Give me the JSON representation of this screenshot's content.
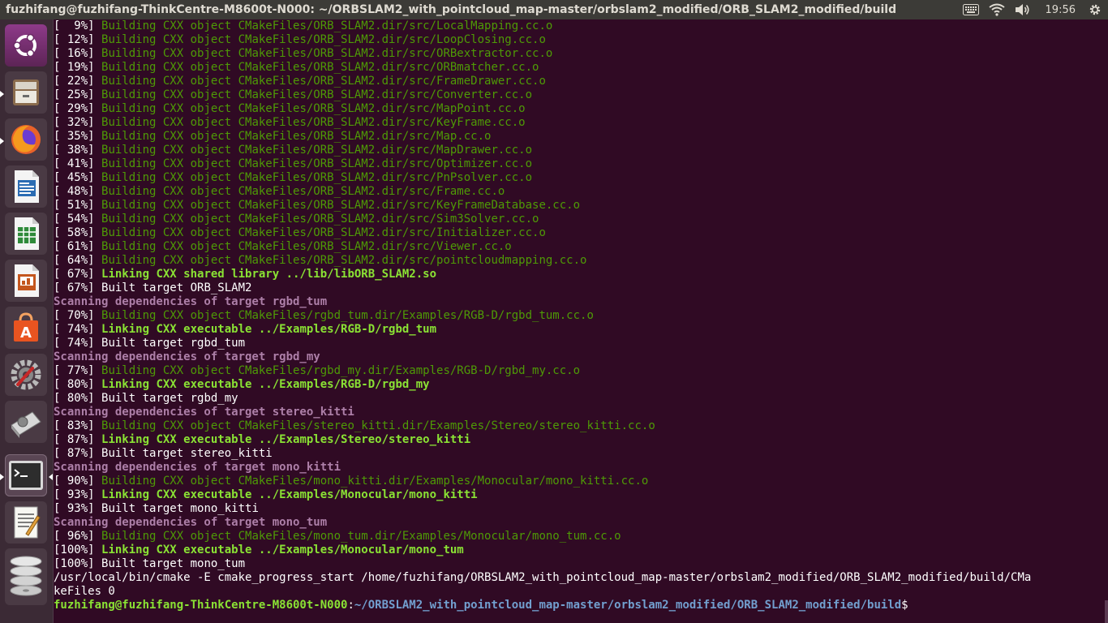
{
  "window": {
    "title": "fuzhifang@fuzhifang-ThinkCentre-M8600t-N000: ~/ORBSLAM2_with_pointcloud_map-master/orbslam2_modified/ORB_SLAM2_modified/build"
  },
  "indicators": {
    "keyboard_icon": "keyboard-icon",
    "wifi_icon": "wifi-icon",
    "volume_icon": "volume-icon",
    "time": "19:56",
    "gear_icon": "gear-icon"
  },
  "launcher": {
    "items": [
      {
        "name": "ubuntu-dash",
        "icon": "ubuntu-logo-icon"
      },
      {
        "name": "files",
        "icon": "files-cabinet-icon"
      },
      {
        "name": "firefox",
        "icon": "firefox-icon"
      },
      {
        "name": "libreoffice-writer",
        "icon": "writer-document-icon"
      },
      {
        "name": "libreoffice-calc",
        "icon": "calc-spreadsheet-icon"
      },
      {
        "name": "libreoffice-impress",
        "icon": "impress-presentation-icon"
      },
      {
        "name": "ubuntu-software",
        "icon": "software-bag-icon"
      },
      {
        "name": "system-settings",
        "icon": "settings-wrench-icon"
      },
      {
        "name": "disk-scanner",
        "icon": "scanner-icon"
      },
      {
        "name": "terminal",
        "icon": "terminal-icon"
      },
      {
        "name": "text-editor",
        "icon": "text-editor-icon"
      },
      {
        "name": "disks",
        "icon": "disk-stack-icon"
      }
    ]
  },
  "terminal": {
    "lines": [
      {
        "pct": "[  9%] ",
        "text": "Building CXX object CMakeFiles/ORB_SLAM2.dir/src/LocalMapping.cc.o"
      },
      {
        "pct": "[ 12%] ",
        "text": "Building CXX object CMakeFiles/ORB_SLAM2.dir/src/LoopClosing.cc.o"
      },
      {
        "pct": "[ 16%] ",
        "text": "Building CXX object CMakeFiles/ORB_SLAM2.dir/src/ORBextractor.cc.o"
      },
      {
        "pct": "[ 19%] ",
        "text": "Building CXX object CMakeFiles/ORB_SLAM2.dir/src/ORBmatcher.cc.o"
      },
      {
        "pct": "[ 22%] ",
        "text": "Building CXX object CMakeFiles/ORB_SLAM2.dir/src/FrameDrawer.cc.o"
      },
      {
        "pct": "[ 25%] ",
        "text": "Building CXX object CMakeFiles/ORB_SLAM2.dir/src/Converter.cc.o"
      },
      {
        "pct": "[ 29%] ",
        "text": "Building CXX object CMakeFiles/ORB_SLAM2.dir/src/MapPoint.cc.o"
      },
      {
        "pct": "[ 32%] ",
        "text": "Building CXX object CMakeFiles/ORB_SLAM2.dir/src/KeyFrame.cc.o"
      },
      {
        "pct": "[ 35%] ",
        "text": "Building CXX object CMakeFiles/ORB_SLAM2.dir/src/Map.cc.o"
      },
      {
        "pct": "[ 38%] ",
        "text": "Building CXX object CMakeFiles/ORB_SLAM2.dir/src/MapDrawer.cc.o"
      },
      {
        "pct": "[ 41%] ",
        "text": "Building CXX object CMakeFiles/ORB_SLAM2.dir/src/Optimizer.cc.o"
      },
      {
        "pct": "[ 45%] ",
        "text": "Building CXX object CMakeFiles/ORB_SLAM2.dir/src/PnPsolver.cc.o"
      },
      {
        "pct": "[ 48%] ",
        "text": "Building CXX object CMakeFiles/ORB_SLAM2.dir/src/Frame.cc.o"
      },
      {
        "pct": "[ 51%] ",
        "text": "Building CXX object CMakeFiles/ORB_SLAM2.dir/src/KeyFrameDatabase.cc.o"
      },
      {
        "pct": "[ 54%] ",
        "text": "Building CXX object CMakeFiles/ORB_SLAM2.dir/src/Sim3Solver.cc.o"
      },
      {
        "pct": "[ 58%] ",
        "text": "Building CXX object CMakeFiles/ORB_SLAM2.dir/src/Initializer.cc.o"
      },
      {
        "pct": "[ 61%] ",
        "text": "Building CXX object CMakeFiles/ORB_SLAM2.dir/src/Viewer.cc.o"
      },
      {
        "pct": "[ 64%] ",
        "text": "Building CXX object CMakeFiles/ORB_SLAM2.dir/src/pointcloudmapping.cc.o"
      },
      {
        "pct": "[ 67%] ",
        "text": "Linking CXX shared library ../lib/libORB_SLAM2.so"
      },
      {
        "pct": "[ 67%] ",
        "text": "Built target ORB_SLAM2"
      },
      {
        "pct": "",
        "text": "Scanning dependencies of target rgbd_tum"
      },
      {
        "pct": "[ 70%] ",
        "text": "Building CXX object CMakeFiles/rgbd_tum.dir/Examples/RGB-D/rgbd_tum.cc.o"
      },
      {
        "pct": "[ 74%] ",
        "text": "Linking CXX executable ../Examples/RGB-D/rgbd_tum"
      },
      {
        "pct": "[ 74%] ",
        "text": "Built target rgbd_tum"
      },
      {
        "pct": "",
        "text": "Scanning dependencies of target rgbd_my"
      },
      {
        "pct": "[ 77%] ",
        "text": "Building CXX object CMakeFiles/rgbd_my.dir/Examples/RGB-D/rgbd_my.cc.o"
      },
      {
        "pct": "[ 80%] ",
        "text": "Linking CXX executable ../Examples/RGB-D/rgbd_my"
      },
      {
        "pct": "[ 80%] ",
        "text": "Built target rgbd_my"
      },
      {
        "pct": "",
        "text": "Scanning dependencies of target stereo_kitti"
      },
      {
        "pct": "[ 83%] ",
        "text": "Building CXX object CMakeFiles/stereo_kitti.dir/Examples/Stereo/stereo_kitti.cc.o"
      },
      {
        "pct": "[ 87%] ",
        "text": "Linking CXX executable ../Examples/Stereo/stereo_kitti"
      },
      {
        "pct": "[ 87%] ",
        "text": "Built target stereo_kitti"
      },
      {
        "pct": "",
        "text": "Scanning dependencies of target mono_kitti"
      },
      {
        "pct": "[ 90%] ",
        "text": "Building CXX object CMakeFiles/mono_kitti.dir/Examples/Monocular/mono_kitti.cc.o"
      },
      {
        "pct": "[ 93%] ",
        "text": "Linking CXX executable ../Examples/Monocular/mono_kitti"
      },
      {
        "pct": "[ 93%] ",
        "text": "Built target mono_kitti"
      },
      {
        "pct": "",
        "text": "Scanning dependencies of target mono_tum"
      },
      {
        "pct": "[ 96%] ",
        "text": "Building CXX object CMakeFiles/mono_tum.dir/Examples/Monocular/mono_tum.cc.o"
      },
      {
        "pct": "[100%] ",
        "text": "Linking CXX executable ../Examples/Monocular/mono_tum"
      },
      {
        "pct": "[100%] ",
        "text": "Built target mono_tum"
      },
      {
        "pct": "",
        "text": "/usr/local/bin/cmake -E cmake_progress_start /home/fuzhifang/ORBSLAM2_with_pointcloud_map-master/orbslam2_modified/ORB_SLAM2_modified/build/CMa"
      },
      {
        "pct": "",
        "text": "keFiles 0"
      }
    ],
    "prompt": {
      "user_host": "fuzhifang@fuzhifang-ThinkCentre-M8600t-N000",
      "colon": ":",
      "path": "~/ORBSLAM2_with_pointcloud_map-master/orbslam2_modified/ORB_SLAM2_modified/build",
      "symbol": "$"
    }
  }
}
